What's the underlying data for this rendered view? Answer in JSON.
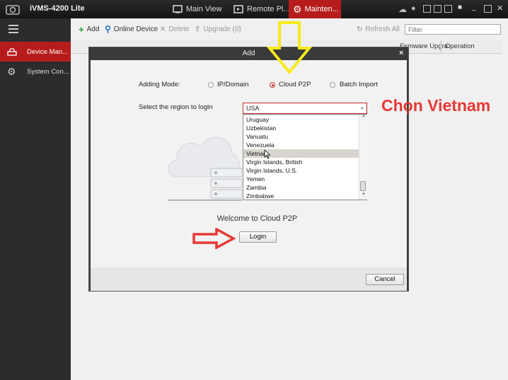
{
  "app": {
    "title": "iVMS-4200 Lite"
  },
  "tabs": [
    {
      "label": "Main View",
      "icon": "main-view-icon"
    },
    {
      "label": "Remote Pl...",
      "icon": "remote-playback-icon"
    },
    {
      "label": "Mainten...",
      "icon": "gear-icon",
      "active": true
    }
  ],
  "sidebar": {
    "items": [
      {
        "label": "Device Man...",
        "icon": "device-icon",
        "active": true
      },
      {
        "label": "System Con...",
        "icon": "gear-icon"
      }
    ]
  },
  "toolbar": {
    "add": "Add",
    "online_device": "Online Device",
    "delete": "Delete",
    "upgrade": "Upgrade (0)",
    "refresh_all": "Refresh All",
    "filter_placeholder": "Filter"
  },
  "table": {
    "columns": [
      "Firmware Upgra...",
      "Operation"
    ]
  },
  "dialog": {
    "title": "Add",
    "adding_mode_label": "Adding Mode:",
    "modes": [
      {
        "label": "IP/Domain",
        "selected": false
      },
      {
        "label": "Cloud P2P",
        "selected": true
      },
      {
        "label": "Batch Import",
        "selected": false
      }
    ],
    "region_label": "Select the region to login",
    "region_value": "USA",
    "region_options": [
      "Uruguay",
      "Uzbekistan",
      "Vanuatu",
      "Venezuela",
      "Vietnam",
      "Virgin Islands, British",
      "Virgin Islands, U.S.",
      "Yemen",
      "Zambia",
      "Zimbabwe"
    ],
    "highlighted_option": "Vietnam",
    "welcome_text": "Welcome to Cloud P2P",
    "login_button": "Login",
    "cancel_button": "Cancel"
  },
  "annotation": {
    "text": "Chọn Vietnam",
    "color": "#e53935"
  },
  "colors": {
    "accent": "#b71c1c",
    "arrow_yellow": "#f7ea1c",
    "arrow_red": "#e53935"
  }
}
